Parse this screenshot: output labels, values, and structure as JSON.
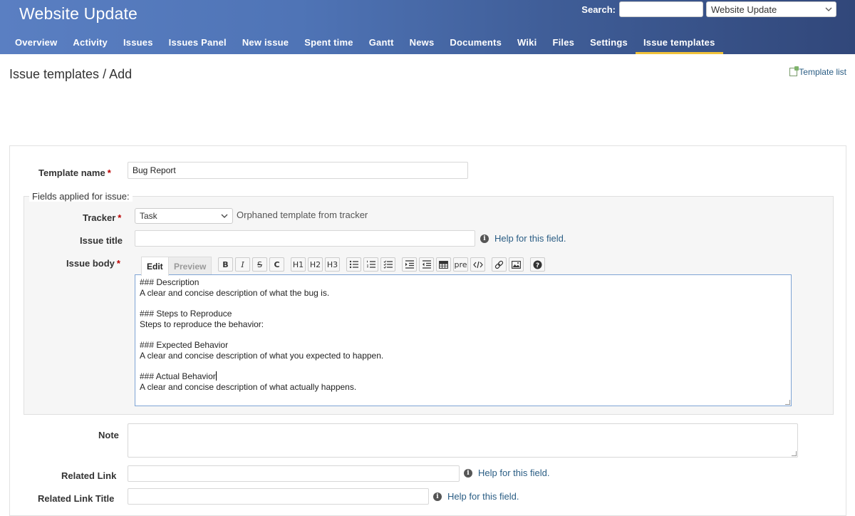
{
  "header": {
    "project_title": "Website Update",
    "search_label": "Search:",
    "search_value": "",
    "project_jump": "Website Update",
    "menu": [
      {
        "label": "Overview"
      },
      {
        "label": "Activity"
      },
      {
        "label": "Issues"
      },
      {
        "label": "Issues Panel"
      },
      {
        "label": "New issue"
      },
      {
        "label": "Spent time"
      },
      {
        "label": "Gantt"
      },
      {
        "label": "News"
      },
      {
        "label": "Documents"
      },
      {
        "label": "Wiki"
      },
      {
        "label": "Files"
      },
      {
        "label": "Settings"
      },
      {
        "label": "Issue templates",
        "selected": true
      }
    ]
  },
  "page": {
    "title": "Issue templates / Add",
    "template_list_link": "Template list"
  },
  "form": {
    "template_name_label": "Template name",
    "template_name_value": "Bug Report",
    "required_mark": "*",
    "fields_legend": "Fields applied for issue:",
    "tracker_label": "Tracker",
    "tracker_value": "Task",
    "orphaned_note": "Orphaned template from tracker",
    "issue_title_label": "Issue title",
    "issue_title_value": "",
    "help_text": "Help for this field.",
    "issue_body_label": "Issue body",
    "tab_edit": "Edit",
    "tab_preview": "Preview",
    "toolbar": {
      "bold": "B",
      "italic": "I",
      "strike": "S",
      "code": "C",
      "h1": "H1",
      "h2": "H2",
      "h3": "H3",
      "pre": "pre"
    },
    "issue_body_value": "### Description\nA clear and concise description of what the bug is.\n\n### Steps to Reproduce\nSteps to reproduce the behavior:\n\n### Expected Behavior\nA clear and concise description of what you expected to happen.\n\n### Actual Behavior",
    "issue_body_tail": "\nA clear and concise description of what actually happens.",
    "note_label": "Note",
    "related_link_label": "Related Link",
    "related_link_title_label": "Related Link Title"
  },
  "colors": {
    "header_start": "#5a7fc2",
    "header_end": "#31477a",
    "selected_tab_underline": "#f0c23a",
    "link": "#2a5d84",
    "required": "#bb0000"
  }
}
